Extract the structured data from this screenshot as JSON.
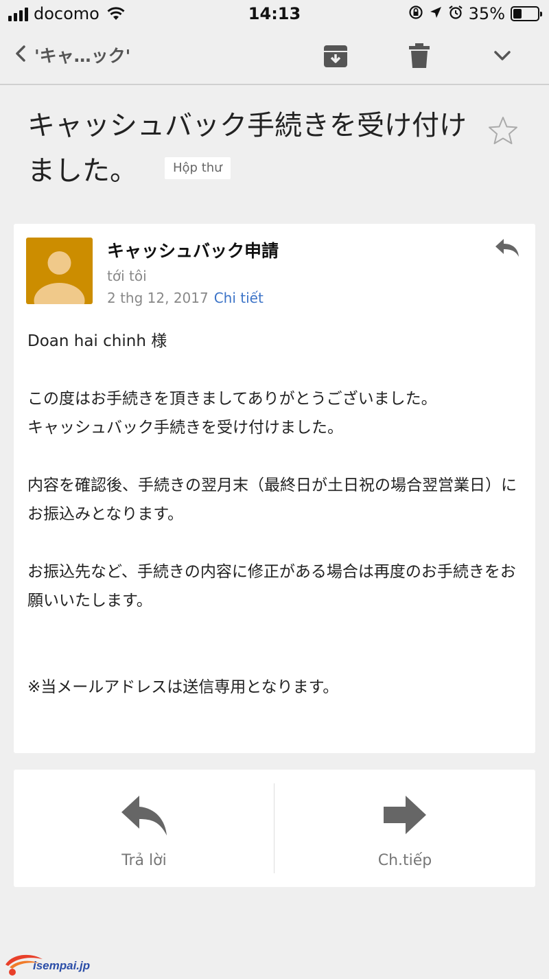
{
  "status": {
    "carrier": "docomo",
    "time": "14:13",
    "battery": "35%",
    "battery_level": 0.35
  },
  "toolbar": {
    "back_label": "'キャ…ック'"
  },
  "subject": {
    "title": "キャッシュバック手続きを受け付けました。",
    "label": "Hộp thư"
  },
  "message": {
    "sender": "キャッシュバック申請",
    "recipient": "tới tôi",
    "date": "2 thg 12, 2017",
    "details_link": "Chi tiết",
    "avatar_color": "#cc8d00",
    "body": {
      "greeting": "Doan hai chinh 様",
      "p1_line1": "この度はお手続きを頂きましてありがとうございました。",
      "p1_line2": "キャッシュバック手続きを受け付けました。",
      "p2": "内容を確認後、手続きの翌月末（最終日が土日祝の場合翌営業日）にお振込みとなります。",
      "p3": "お振込先など、手続きの内容に修正がある場合は再度のお手続きをお願いいたします。",
      "note": "※当メールアドレスは送信専用となります。"
    }
  },
  "actions": {
    "reply": "Trả lời",
    "forward": "Ch.tiếp"
  },
  "watermark": {
    "text": "isempai.jp"
  }
}
